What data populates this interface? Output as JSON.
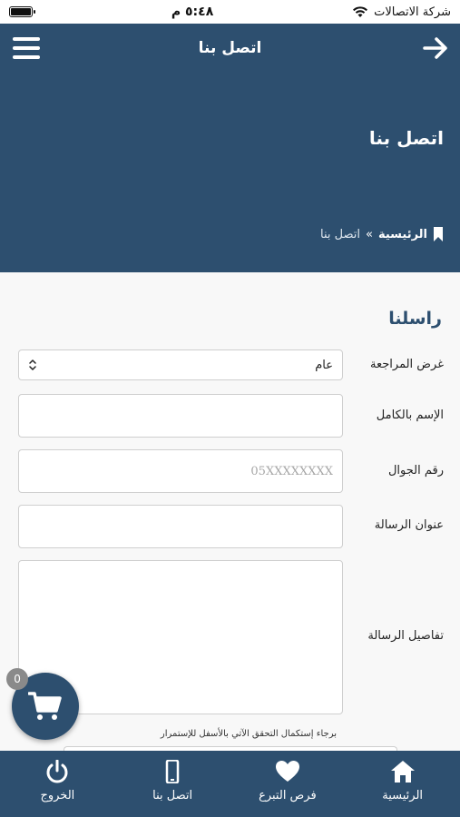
{
  "status_bar": {
    "carrier": "شركة الاتصالات",
    "time": "٥:٤٨ م"
  },
  "app_bar": {
    "title": "اتصل بنا",
    "back_icon": "arrow-right-icon",
    "menu_icon": "hamburger-menu-icon"
  },
  "hero": {
    "title": "اتصل بنا",
    "breadcrumb": {
      "home": "الرئيسية",
      "separator": "»",
      "current": "اتصل بنا"
    }
  },
  "form": {
    "section_title": "راسلنا",
    "purpose_label": "غرض المراجعة",
    "purpose_value": "عام",
    "fullname_label": "الإسم بالكامل",
    "fullname_value": "",
    "mobile_label": "رقم الجوال",
    "mobile_placeholder": "05XXXXXXXX",
    "subject_label": "عنوان الرسالة",
    "subject_value": "",
    "details_label": "تفاصيل الرسالة",
    "details_value": "",
    "captcha_hint": "برجاء إستكمال التحقق الآتي بالأسفل للإستمرار"
  },
  "cart": {
    "count": "0",
    "icon": "shopping-cart-icon"
  },
  "bottom_nav": [
    {
      "label": "الرئيسية",
      "icon": "home-icon"
    },
    {
      "label": "فرص التبرع",
      "icon": "heart-icon"
    },
    {
      "label": "اتصل بنا",
      "icon": "mobile-phone-icon"
    },
    {
      "label": "الخروج",
      "icon": "power-icon"
    }
  ],
  "colors": {
    "primary": "#2d4f6f",
    "background": "#f8f8f8",
    "badge": "#8a8a8a"
  }
}
